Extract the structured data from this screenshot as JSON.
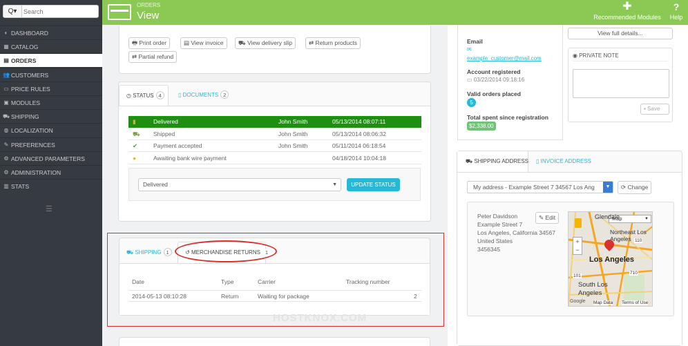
{
  "sidebar": {
    "search_placeholder": "Search",
    "search_glyph": "Q▾",
    "items": [
      {
        "label": "DASHBOARD",
        "icon": "dashboard-icon"
      },
      {
        "label": "CATALOG",
        "icon": "catalog-icon"
      },
      {
        "label": "ORDERS",
        "icon": "orders-icon",
        "active": true
      },
      {
        "label": "CUSTOMERS",
        "icon": "customers-icon"
      },
      {
        "label": "PRICE RULES",
        "icon": "price-rules-icon"
      },
      {
        "label": "MODULES",
        "icon": "modules-icon"
      },
      {
        "label": "SHIPPING",
        "icon": "shipping-icon"
      },
      {
        "label": "LOCALIZATION",
        "icon": "globe-icon"
      },
      {
        "label": "PREFERENCES",
        "icon": "wrench-icon"
      },
      {
        "label": "ADVANCED PARAMETERS",
        "icon": "cogs-icon"
      },
      {
        "label": "ADMINISTRATION",
        "icon": "cog-icon"
      },
      {
        "label": "STATS",
        "icon": "bar-chart-icon"
      }
    ]
  },
  "header": {
    "breadcrumb": "ORDERS",
    "title": "View",
    "recommended": "Recommended Modules",
    "help": "Help"
  },
  "actions": {
    "print_order": "Print order",
    "view_invoice": "View invoice",
    "view_delivery_slip": "View delivery slip",
    "return_products": "Return products",
    "partial_refund": "Partial refund"
  },
  "status_tabs": {
    "status": "STATUS",
    "status_count": "4",
    "documents": "DOCUMENTS",
    "documents_count": "2"
  },
  "status_rows": [
    {
      "status": "Delivered",
      "employee": "John Smith",
      "date": "05/13/2014 08:07:11"
    },
    {
      "status": "Shipped",
      "employee": "John Smith",
      "date": "05/13/2014 08:06:32"
    },
    {
      "status": "Payment accepted",
      "employee": "John Smith",
      "date": "05/11/2014 06:18:54"
    },
    {
      "status": "Awaiting bank wire payment",
      "employee": "",
      "date": "04/18/2014 10:04:18"
    }
  ],
  "status_select": "Delivered",
  "update_status": "UPDATE STATUS",
  "ship_tabs": {
    "shipping": "SHIPPING",
    "shipping_count": "1",
    "returns": "MERCHANDISE RETURNS",
    "returns_count": "1"
  },
  "returns_table": {
    "headers": [
      "Date",
      "Type",
      "Carrier",
      "Tracking number"
    ],
    "rows": [
      {
        "date": "2014-05-13 08:10:28",
        "type": "Return",
        "carrier": "Waiting for package",
        "tracking": "2"
      }
    ]
  },
  "customer": {
    "email_label": "Email",
    "email": "example_customer@mail.com",
    "registered_label": "Account registered",
    "registered": "03/22/2014 09:18:16",
    "valid_label": "Valid orders placed",
    "valid": "5",
    "spent_label": "Total spent since registration",
    "spent": "$2,338.00"
  },
  "view_full": "View full details...",
  "private_note": {
    "title": "PRIVATE NOTE",
    "save": "Save"
  },
  "addr_tabs": {
    "shipping": "SHIPPING ADDRESS",
    "invoice": "INVOICE ADDRESS"
  },
  "address_select": "My address - Example Street 7 34567 Los Ang",
  "change": "Change",
  "address": {
    "name": "Peter Davidson",
    "street": "Example Street 7",
    "city": "Los Angeles, California 34567",
    "country": "United States",
    "phone": "3456345"
  },
  "edit": "Edit",
  "map": {
    "type": "Map",
    "glendale": "Glendale",
    "northeast": "Northeast Los Angeles",
    "los_angeles": "Los Angeles",
    "south": "South Los Angeles",
    "map_data": "Map Data",
    "terms": "Terms of Use",
    "google": "Google",
    "h101": "101",
    "h110": "110",
    "h710": "710"
  },
  "watermark": "HOSTKNOX.COM",
  "colors": {
    "header_green": "#8bc954",
    "accent": "#25b9d7",
    "status_green": "#1f8f12",
    "highlight_red": "#d9312b"
  }
}
